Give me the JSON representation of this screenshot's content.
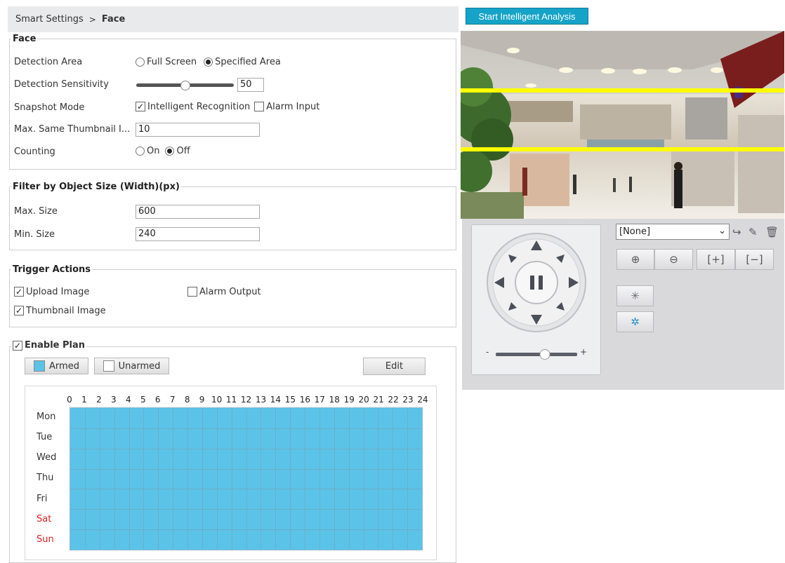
{
  "breadcrumb": {
    "parent": "Smart Settings",
    "separator": ">",
    "current": "Face"
  },
  "face": {
    "legend": "Face",
    "detection_area": {
      "label": "Detection Area",
      "options": [
        "Full Screen",
        "Specified Area"
      ],
      "selected": "Specified Area"
    },
    "sensitivity": {
      "label": "Detection Sensitivity",
      "value": "50",
      "level_pct": 50
    },
    "snapshot_mode": {
      "label": "Snapshot Mode",
      "options": [
        {
          "label": "Intelligent Recognition",
          "checked": true
        },
        {
          "label": "Alarm Input",
          "checked": false
        }
      ]
    },
    "max_thumbnail": {
      "label": "Max. Same Thumbnail I...",
      "value": "10"
    },
    "counting": {
      "label": "Counting",
      "options": [
        "On",
        "Off"
      ],
      "selected": "Off"
    }
  },
  "filter": {
    "legend": "Filter by Object Size (Width)(px)",
    "max": {
      "label": "Max. Size",
      "value": "600"
    },
    "min": {
      "label": "Min. Size",
      "value": "240"
    }
  },
  "trigger": {
    "legend": "Trigger Actions",
    "upload_image": {
      "label": "Upload Image",
      "checked": true
    },
    "alarm_output": {
      "label": "Alarm Output",
      "checked": false
    },
    "thumbnail_image": {
      "label": "Thumbnail Image",
      "checked": true
    }
  },
  "plan": {
    "legend": "Enable Plan",
    "enabled": true,
    "armed_label": "Armed",
    "unarmed_label": "Unarmed",
    "edit_label": "Edit",
    "armed_color": "#5cc3e8",
    "hours": [
      "0",
      "1",
      "2",
      "3",
      "4",
      "5",
      "6",
      "7",
      "8",
      "9",
      "10",
      "11",
      "12",
      "13",
      "14",
      "15",
      "16",
      "17",
      "18",
      "19",
      "20",
      "21",
      "22",
      "23",
      "24"
    ],
    "days": [
      "Mon",
      "Tue",
      "Wed",
      "Thu",
      "Fri",
      "Sat",
      "Sun"
    ],
    "weekend_color": "#e02020"
  },
  "right": {
    "start_button": "Start Intelligent Analysis",
    "start_color": "#16a3c8",
    "detection_line_color": "#ffff00",
    "preset": {
      "value": "[None]"
    },
    "zoom_minus_label": "-",
    "zoom_plus_label": "+"
  }
}
